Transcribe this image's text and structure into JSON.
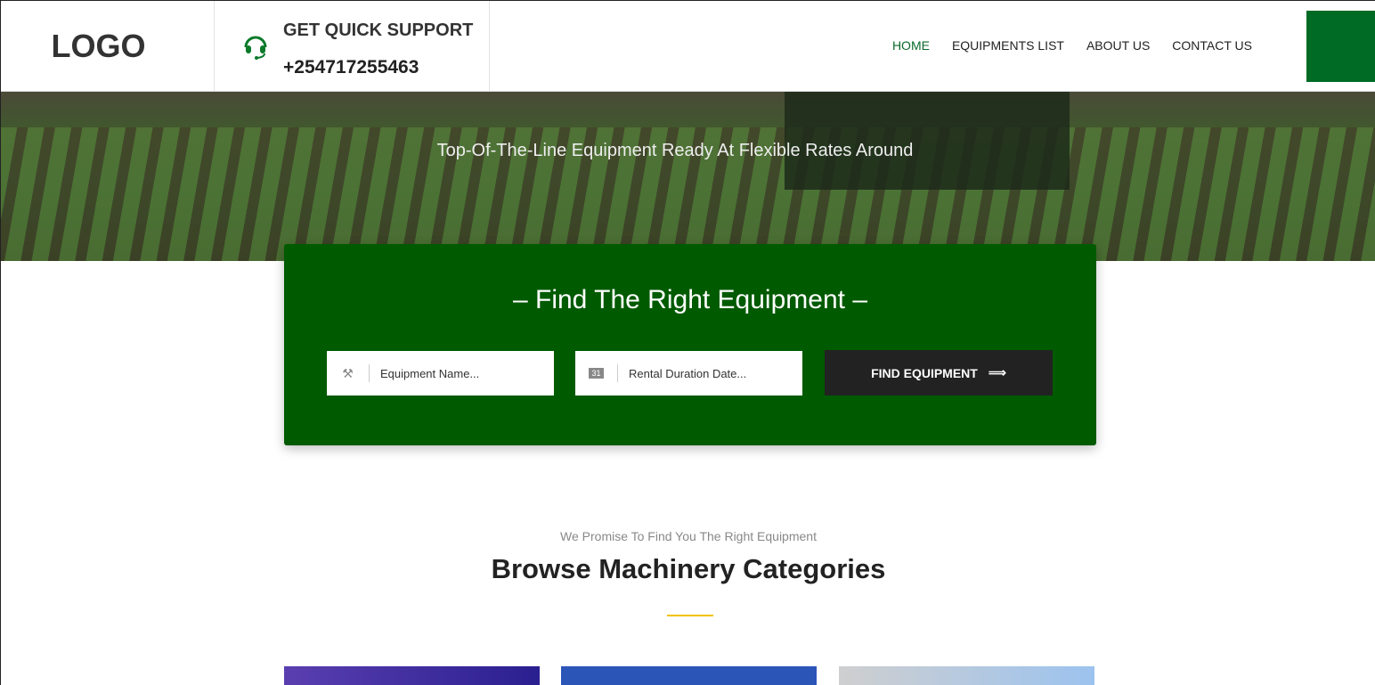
{
  "header": {
    "logo": "LOGO",
    "support_title": "GET QUICK SUPPORT",
    "support_phone": "+254717255463",
    "nav": [
      {
        "label": "HOME",
        "active": true
      },
      {
        "label": "EQUIPMENTS LIST"
      },
      {
        "label": "ABOUT US"
      },
      {
        "label": "CONTACT US"
      }
    ]
  },
  "hero": {
    "tagline": "Top-Of-The-Line Equipment Ready At Flexible Rates Around"
  },
  "finder": {
    "title": "Find The Right Equipment",
    "equipment_placeholder": "Equipment Name...",
    "date_placeholder": "Rental Duration Date...",
    "button": "FIND EQUIPMENT",
    "calendar_day": "31"
  },
  "section": {
    "subtitle": "We Promise To Find You The Right Equipment",
    "title": "Browse Machinery Categories"
  },
  "colors": {
    "brand_green": "#005a00",
    "accent_yellow": "#f2c200",
    "nav_active": "#0a6a2a"
  }
}
